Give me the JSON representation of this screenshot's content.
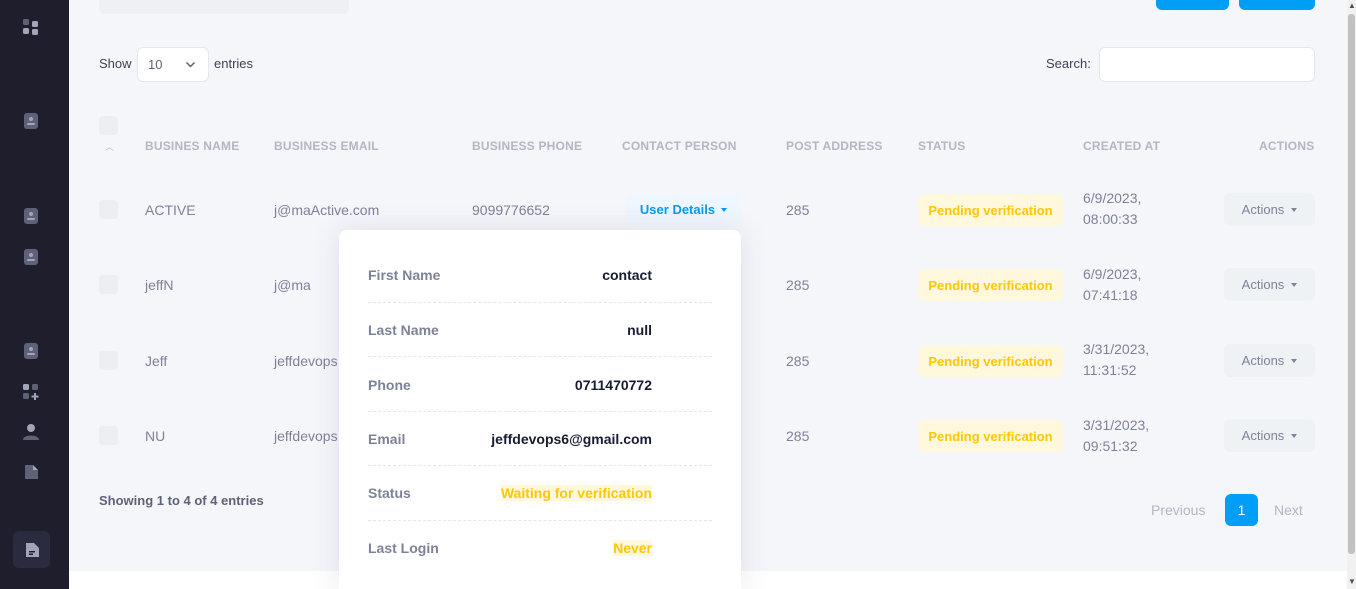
{
  "sidebar": {
    "icons": [
      "dashboard-icon",
      "contact-card-icon",
      "contact-card-icon",
      "contact-card-icon",
      "contact-card-icon",
      "add-module-icon",
      "user-icon",
      "document-icon",
      "document-active-icon"
    ]
  },
  "controls": {
    "show_label": "Show",
    "entries_value": "10",
    "entries_label": "entries",
    "search_label": "Search:",
    "search_value": ""
  },
  "table": {
    "headers": [
      "BUSINES NAME",
      "BUSINESS EMAIL",
      "BUSINESS PHONE",
      "CONTACT PERSON",
      "POST ADDRESS",
      "STATUS",
      "CREATED AT",
      "ACTIONS"
    ],
    "rows": [
      {
        "name": "ACTIVE",
        "email": "j@maActive.com",
        "phone": "9099776652",
        "contact": "User Details",
        "address": "285",
        "status": "Pending verification",
        "created_date": "6/9/2023,",
        "created_time": "08:00:33",
        "actions": "Actions"
      },
      {
        "name": "jeffN",
        "email": "j@ma",
        "phone": "",
        "contact": "",
        "address": "285",
        "status": "Pending verification",
        "created_date": "6/9/2023,",
        "created_time": "07:41:18",
        "actions": "Actions"
      },
      {
        "name": "Jeff",
        "email": "jeffdevops",
        "phone": "",
        "contact": "",
        "address": "285",
        "status": "Pending verification",
        "created_date": "3/31/2023,",
        "created_time": "11:31:52",
        "actions": "Actions"
      },
      {
        "name": "NU",
        "email": "jeffdevops",
        "phone": "",
        "contact": "",
        "address": "285",
        "status": "Pending verification",
        "created_date": "3/31/2023,",
        "created_time": "09:51:32",
        "actions": "Actions"
      }
    ]
  },
  "popover": {
    "rows": [
      {
        "label": "First Name",
        "value": "contact"
      },
      {
        "label": "Last Name",
        "value": "null"
      },
      {
        "label": "Phone",
        "value": "0711470772"
      },
      {
        "label": "Email",
        "value": "jeffdevops6@gmail.com"
      },
      {
        "label": "Status",
        "value": "Waiting for verification"
      },
      {
        "label": "Last Login",
        "value": "Never"
      }
    ]
  },
  "footer": {
    "showing": "Showing 1 to 4 of 4 entries",
    "previous": "Previous",
    "page": "1",
    "next": "Next"
  },
  "colors": {
    "primary": "#009ef7",
    "warning": "#ffc700",
    "warning_light": "#fff8dd",
    "sidebar": "#1e1e2d"
  }
}
